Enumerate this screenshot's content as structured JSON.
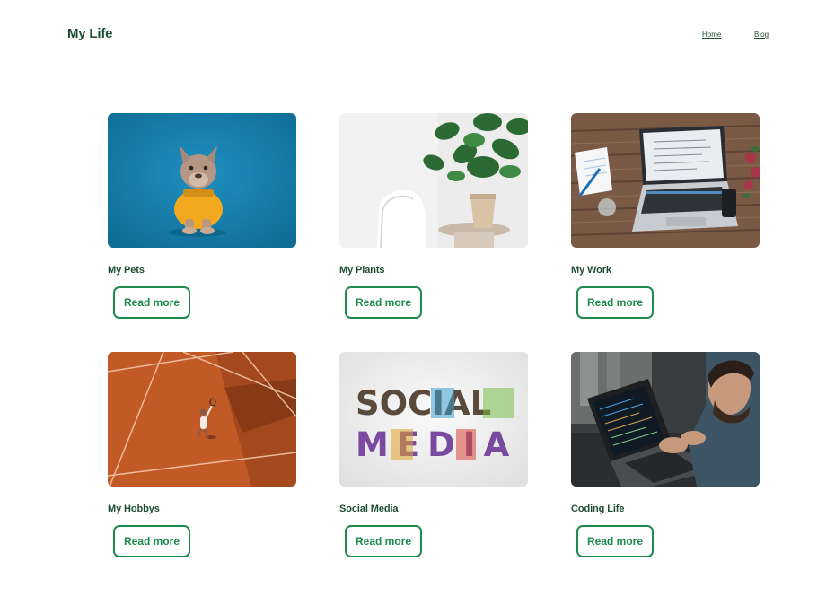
{
  "header": {
    "brand": "My Life",
    "nav": {
      "home": "Home",
      "blog": "Blog"
    }
  },
  "cards": [
    {
      "title": "My Pets",
      "button": "Read more",
      "image": "french-bulldog-photo"
    },
    {
      "title": "My Plants",
      "button": "Read more",
      "image": "houseplant-chair-photo"
    },
    {
      "title": "My Work",
      "button": "Read more",
      "image": "laptop-desk-photo"
    },
    {
      "title": "My Hobbys",
      "button": "Read more",
      "image": "tennis-court-photo"
    },
    {
      "title": "Social Media",
      "button": "Read more",
      "image": "social-media-letters-photo"
    },
    {
      "title": "Coding Life",
      "button": "Read more",
      "image": "man-coding-laptop-photo"
    }
  ],
  "social_letters": {
    "line1": "SOCIAL",
    "line2": "MEDIA"
  },
  "colors": {
    "accent": "#1e8a4c",
    "text": "#1f4d33"
  }
}
